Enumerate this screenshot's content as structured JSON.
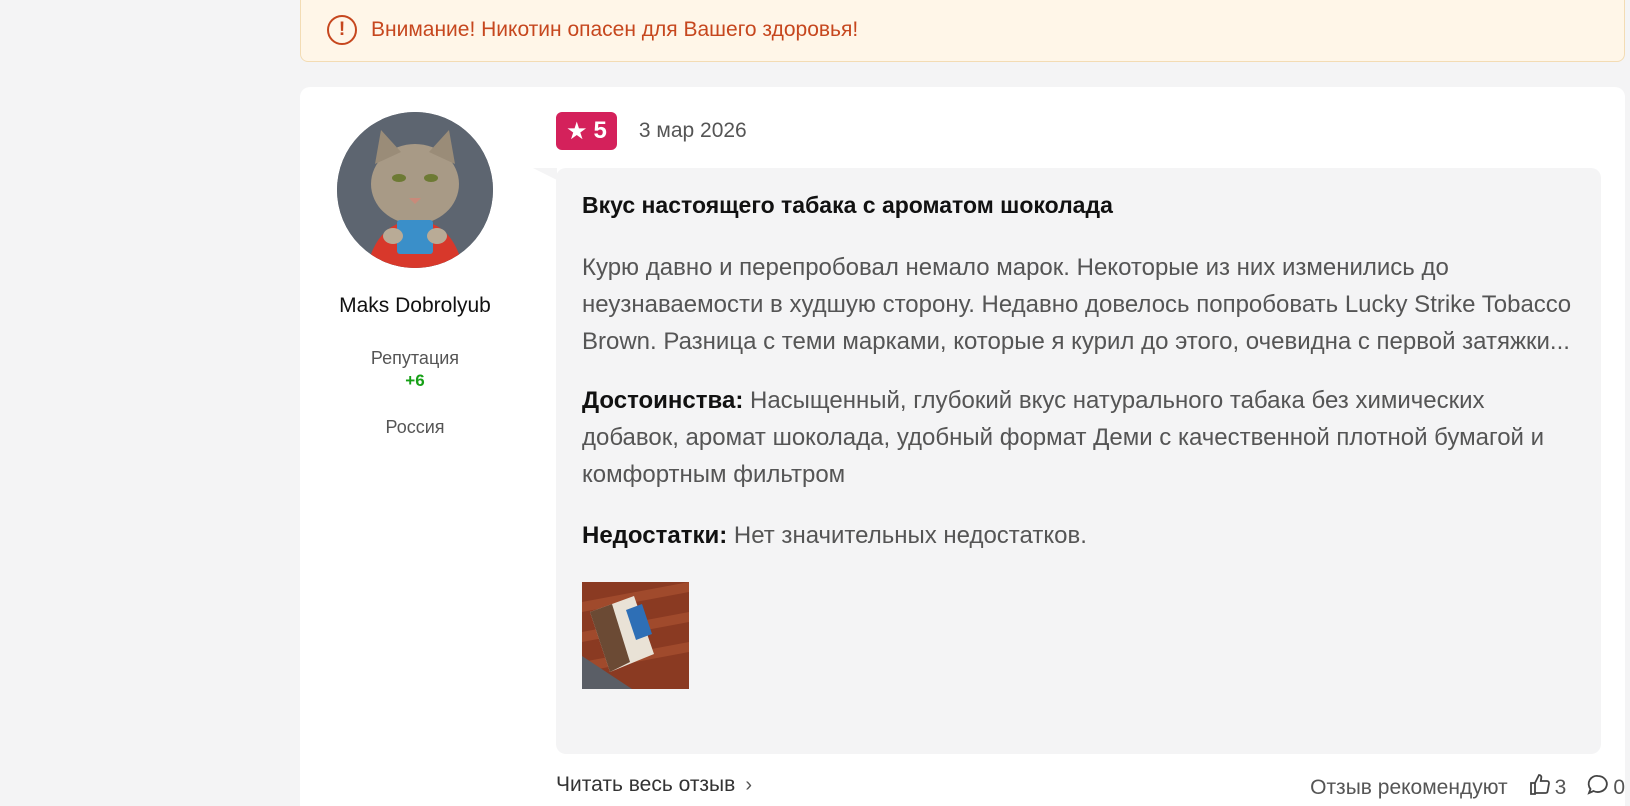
{
  "warning": {
    "text": "Внимание! Никотин опасен для Вашего здоровья!"
  },
  "author": {
    "name": "Maks Dobrolyub",
    "reputation_label": "Репутация",
    "reputation_value": "+6",
    "country": "Россия"
  },
  "review": {
    "rating": "5",
    "date": "3 мар 2026",
    "title": "Вкус настоящего табака с ароматом шоколада",
    "body": "Курю давно и перепробовал немало марок. Некоторые из них изменились до неузнаваемости в худшую сторону. Недавно довелось попробовать Lucky Strike Tobacco Brown. Разница с теми марками, которые я курил до этого, очевидна с первой затяжки...",
    "pros_label": "Достоинства:",
    "pros_text": "Насыщенный, глубокий вкус натурального табака без химических добавок, аромат шоколада, удобный формат Деми с качественной плотной бумагой и комфортным фильтром",
    "cons_label": "Недостатки:",
    "cons_text": "Нет значительных недостатков."
  },
  "footer": {
    "read_more": "Читать весь отзыв",
    "recommend_label": "Отзыв рекомендуют",
    "likes": "3",
    "comments": "0"
  },
  "colors": {
    "accent_rating": "#d4215b",
    "warning_text": "#c6471e",
    "reputation_positive": "#16a016"
  },
  "icons": [
    "exclamation-circle-icon",
    "star-icon",
    "chevron-right-icon",
    "thumbs-up-icon",
    "comment-icon"
  ]
}
